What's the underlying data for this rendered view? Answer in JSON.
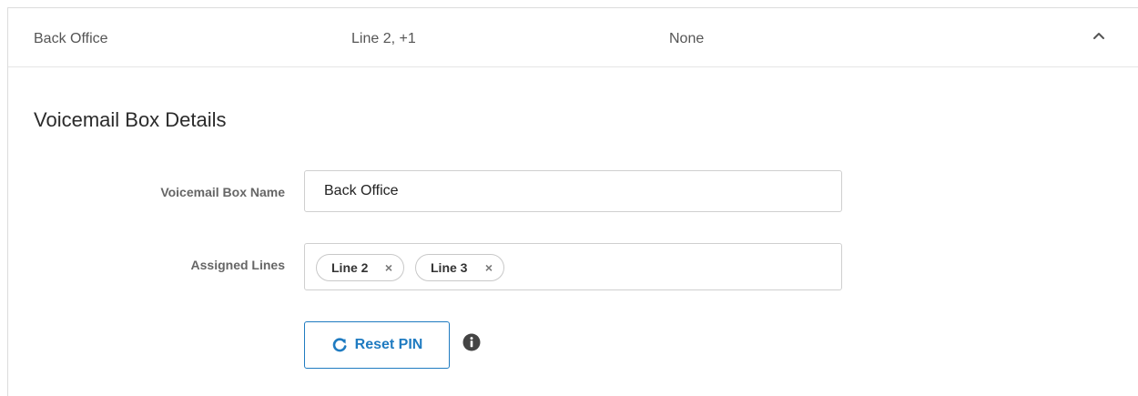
{
  "row": {
    "name": "Back Office",
    "lines": "Line 2, +1",
    "greeting": "None",
    "toggle_icon": "chevron-up-icon"
  },
  "details": {
    "title": "Voicemail Box Details",
    "name_label": "Voicemail Box Name",
    "name_value": "Back Office",
    "lines_label": "Assigned Lines",
    "assigned_lines": [
      {
        "label": "Line 2",
        "remove": "×"
      },
      {
        "label": "Line 3",
        "remove": "×"
      }
    ],
    "reset_label": "Reset PIN",
    "reset_icon": "refresh-icon",
    "info_icon": "info-icon"
  },
  "colors": {
    "accent": "#1f7bc1",
    "border": "#cfcfcf",
    "text_muted": "#555555"
  }
}
